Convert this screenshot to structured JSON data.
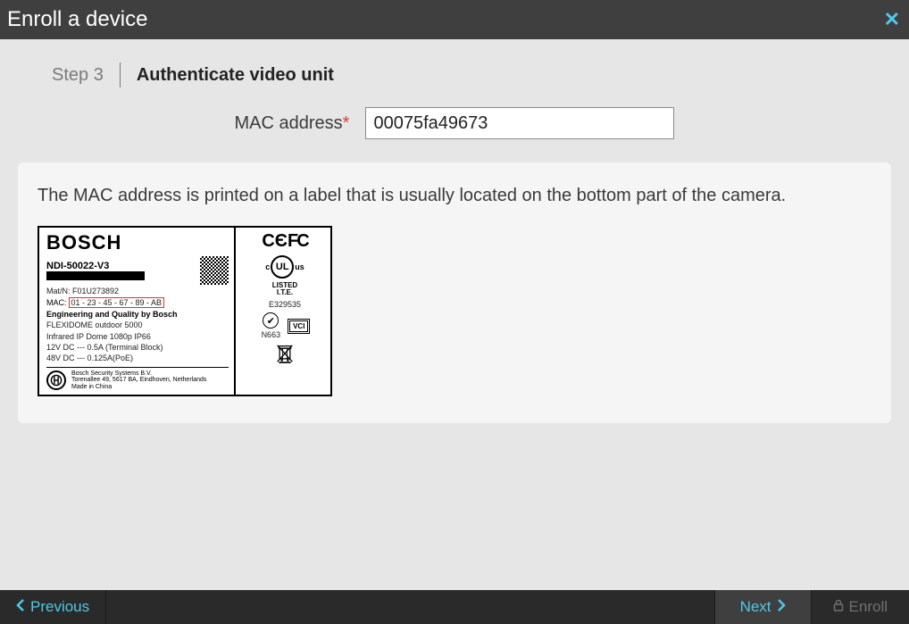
{
  "titlebar": {
    "title": "Enroll a device"
  },
  "step": {
    "label": "Step 3",
    "title": "Authenticate video unit"
  },
  "form": {
    "mac_label": "MAC address",
    "required_mark": "*",
    "mac_value": "00075fa49673"
  },
  "help": {
    "text": "The MAC address is printed on a label that is usually located on the bottom part of the camera."
  },
  "label_illustration": {
    "brand": "BOSCH",
    "model": "NDI-50022-V3",
    "matn": "Mat/N: F01U273892",
    "mac_prefix": "MAC:",
    "mac_example": "01 - 23 - 45 - 67 - 89 - AB",
    "eq": "Engineering and Quality by Bosch",
    "product": "FLEXIDOME outdoor 5000",
    "desc": "Infrared IP Dome 1080p IP66",
    "power1": "12V DC --- 0.5A (Terminal Block)",
    "power2": "48V DC --- 0.125A(PoE)",
    "company": "Bosch Security Systems B.V.",
    "address": "Torenallee 49, 5617 BA, Eindhoven, Netherlands",
    "made": "Made in China",
    "cefc": "C€FC",
    "listed": "LISTED",
    "ite": "I.T.E.",
    "enum": "E329535",
    "n663": "N663",
    "vci": "VCI"
  },
  "footer": {
    "previous": "Previous",
    "next": "Next",
    "enroll": "Enroll"
  }
}
